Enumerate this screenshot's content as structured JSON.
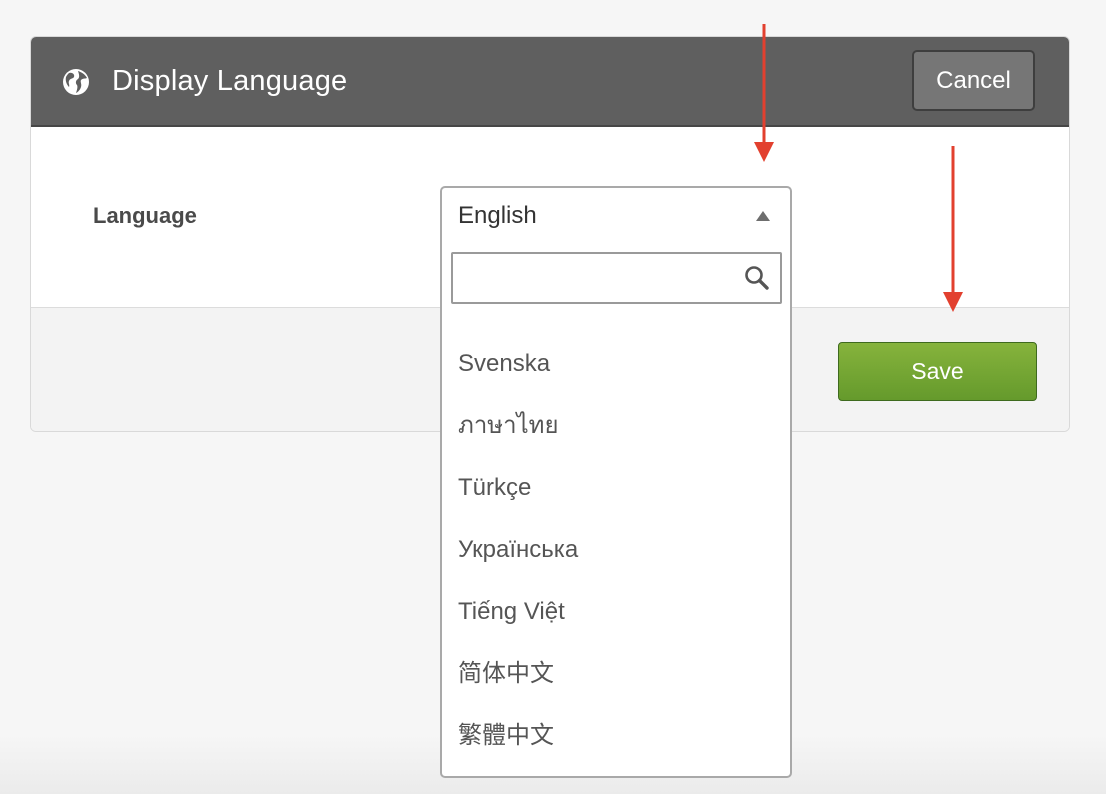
{
  "dialog": {
    "title": "Display Language",
    "globe_icon": "globe-icon",
    "cancel_label": "Cancel",
    "save_label": "Save",
    "header_color": "#5f5f5f",
    "save_color": "#659a2c"
  },
  "form": {
    "language_label": "Language",
    "selected_value": "English",
    "search_placeholder": ""
  },
  "dropdown": {
    "options": [
      "Svenska",
      "ภาษาไทย",
      "Türkçe",
      "Українська",
      "Tiếng Việt",
      "简体中文",
      "繁體中文"
    ]
  },
  "annotations": {
    "arrow_color": "#e2402f"
  }
}
